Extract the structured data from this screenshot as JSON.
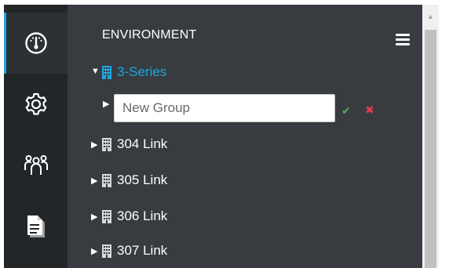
{
  "sidebar": {
    "items": [
      {
        "icon": "dashboard-gauge-icon",
        "active": true
      },
      {
        "icon": "gear-icon",
        "active": false
      },
      {
        "icon": "users-group-icon",
        "active": false
      },
      {
        "icon": "documents-icon",
        "active": false
      }
    ]
  },
  "header": {
    "title": "ENVIRONMENT",
    "menu_icon": "hamburger-menu-icon"
  },
  "tree": {
    "root": {
      "label": "3-Series",
      "expanded": true,
      "icon": "building-icon"
    },
    "new_group": {
      "placeholder": "New Group",
      "confirm_icon": "checkmark-icon",
      "cancel_icon": "close-x-icon"
    },
    "children": [
      {
        "label": "304 Link",
        "icon": "building-icon"
      },
      {
        "label": "305 Link",
        "icon": "building-icon"
      },
      {
        "label": "306 Link",
        "icon": "building-icon"
      },
      {
        "label": "307 Link",
        "icon": "building-icon"
      }
    ]
  },
  "colors": {
    "accent": "#1da7e0",
    "panel_bg": "#383c40",
    "rail_bg": "#222629",
    "confirm": "#4caf50",
    "cancel": "#e53950"
  }
}
